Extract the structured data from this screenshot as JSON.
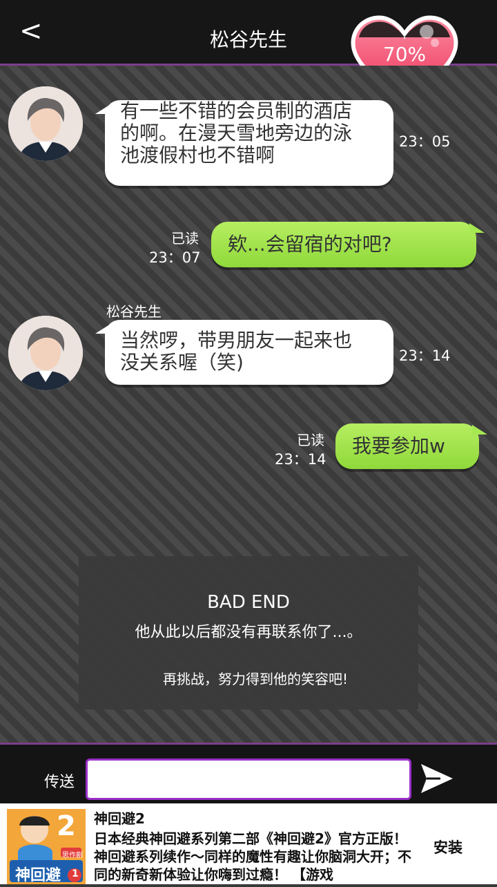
{
  "header": {
    "back_icon": "chevron-left-icon",
    "back_glyph": "<",
    "title": "松谷先生",
    "affection": "70%"
  },
  "messages": {
    "m1": {
      "lines": [
        "有一些不错的会员制的酒店",
        "的啊。在漫天雪地旁边的泳",
        "池渡假村也不错啊"
      ],
      "time": "23：05"
    },
    "m2": {
      "read": "已读",
      "time": "23：07",
      "text": "欸...会留宿的对吧?"
    },
    "m3": {
      "sender": "松谷先生",
      "lines": [
        "当然啰，带男朋友一起来也",
        "没关系喔（笑)"
      ],
      "time": "23：14"
    },
    "m4": {
      "read": "已读",
      "time": "23：14",
      "text": "我要参加w"
    }
  },
  "ending": {
    "title": "BAD END",
    "message": "他从此以后都没有再联系你了...。",
    "retry": "再挑战，努力得到他的笑容吧!"
  },
  "input_bar": {
    "label": "传送",
    "value": "",
    "send_icon": "send-arrow-icon"
  },
  "ad": {
    "name": "神回避2",
    "description": "日本经典神回避系列第二部《神回避2》官方正版！ 神回避系列续作～同样的魔性有趣让你脑洞大开；不同的新奇新体验让你嗨到过瘾！ 【游戏",
    "install": "安装",
    "logo_text": "神回避",
    "logo_number": "2",
    "logo_tag": "思作剧",
    "logo_badge": "1"
  },
  "colors": {
    "accent": "#7b3f8e",
    "bubble_out": "#9be046",
    "heart": "#f04a6a"
  }
}
